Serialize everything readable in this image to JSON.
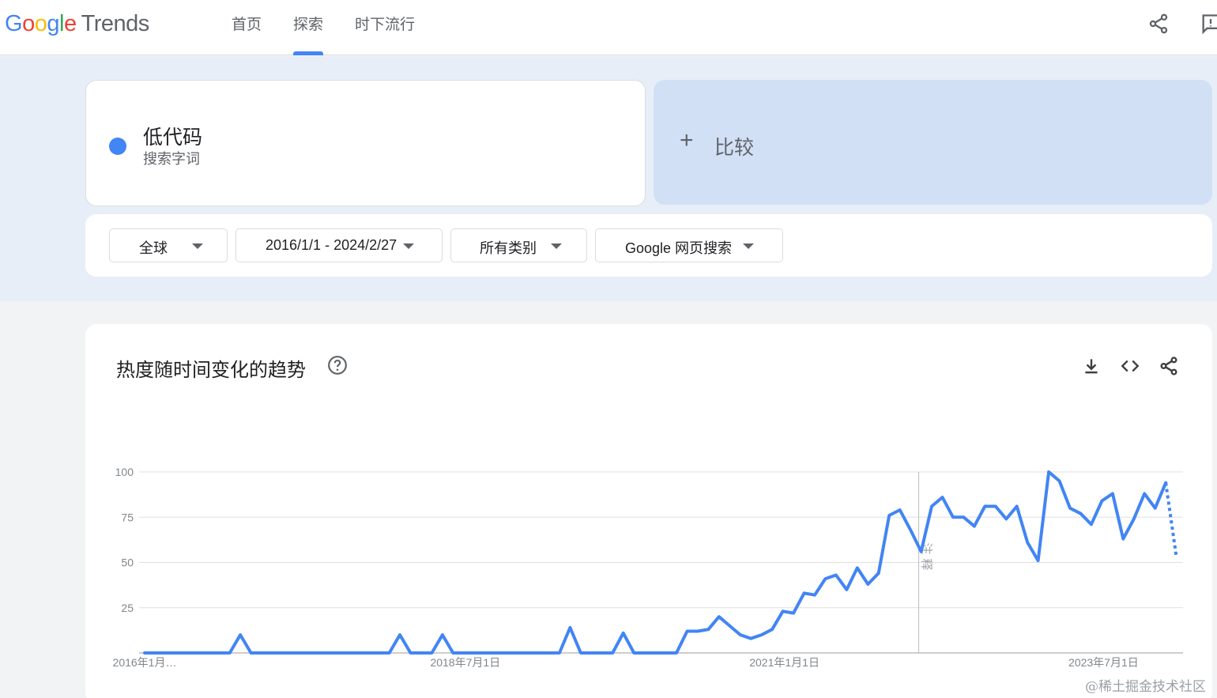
{
  "header": {
    "logo_google": [
      "G",
      "o",
      "o",
      "g",
      "l",
      "e"
    ],
    "logo_trends": "Trends",
    "nav": [
      {
        "label": "首页",
        "active": false
      },
      {
        "label": "探索",
        "active": true
      },
      {
        "label": "时下流行",
        "active": false
      }
    ],
    "icons": [
      "share-icon",
      "feedback-icon"
    ]
  },
  "term": {
    "name": "低代码",
    "type": "搜索字词",
    "color": "#4285f4"
  },
  "compare": {
    "plus": "+",
    "label": "比较"
  },
  "filters": {
    "region": "全球",
    "date_range": "2016/1/1 - 2024/2/27",
    "category": "所有类别",
    "search_type": "Google 网页搜索"
  },
  "chart_section": {
    "title": "热度随时间变化的趋势",
    "icons": [
      "help-icon",
      "download-icon",
      "embed-icon",
      "share-icon"
    ]
  },
  "chart_data": {
    "type": "line",
    "title": "",
    "xlabel": "",
    "ylabel": "",
    "ylim": [
      0,
      100
    ],
    "yticks": [
      25,
      50,
      75,
      100
    ],
    "x_start": "2016-01",
    "x_step": "month",
    "x_tick_labels": [
      {
        "label": "2016年1月…",
        "index": 0
      },
      {
        "label": "2018年7月1日",
        "index": 30
      },
      {
        "label": "2021年1月1日",
        "index": 60
      },
      {
        "label": "2023年7月1日",
        "index": 90
      }
    ],
    "values": [
      0,
      0,
      0,
      0,
      0,
      0,
      0,
      0,
      0,
      10,
      0,
      0,
      0,
      0,
      0,
      0,
      0,
      0,
      0,
      0,
      0,
      0,
      0,
      0,
      10,
      0,
      0,
      0,
      10,
      0,
      0,
      0,
      0,
      0,
      0,
      0,
      0,
      0,
      0,
      0,
      14,
      0,
      0,
      0,
      0,
      11,
      0,
      0,
      0,
      0,
      0,
      12,
      12,
      13,
      20,
      15,
      10,
      8,
      10,
      13,
      23,
      22,
      33,
      32,
      41,
      43,
      35,
      47,
      38,
      44,
      76,
      79,
      68,
      56,
      81,
      86,
      75,
      75,
      70,
      81,
      81,
      74,
      81,
      61,
      51,
      100,
      95,
      80,
      77,
      71,
      84,
      88,
      63,
      74,
      88,
      80,
      94
    ],
    "partial_last_value": 53,
    "annotation": {
      "label": "注释",
      "index": 73
    },
    "series_color": "#4285f4",
    "grid": true
  },
  "watermark": "@稀土掘金技术社区"
}
